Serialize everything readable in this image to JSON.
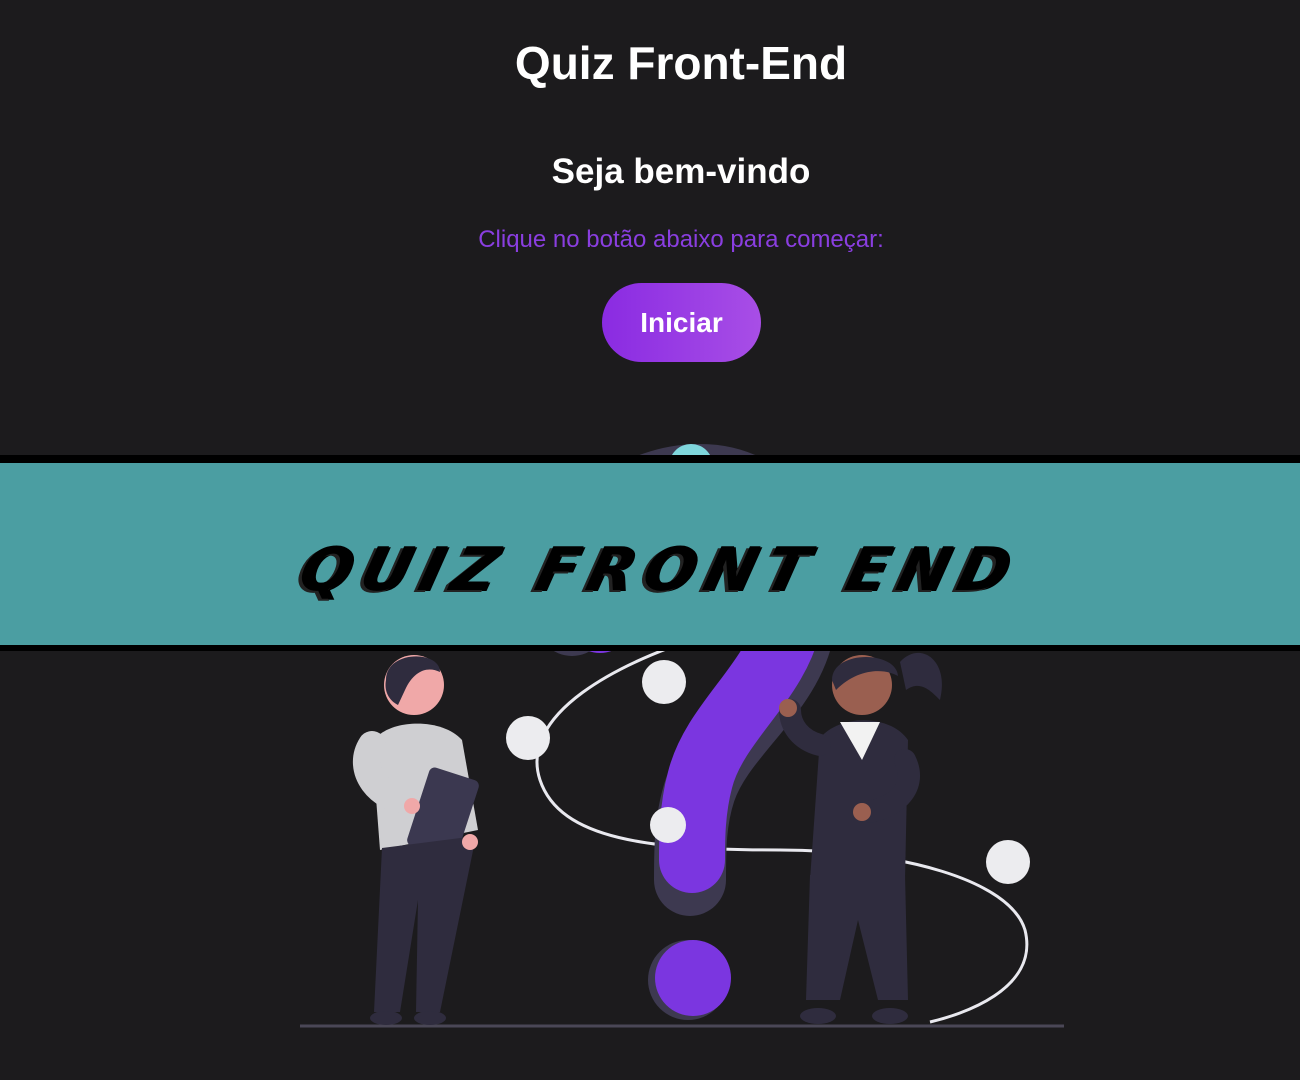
{
  "header": {
    "title": "Quiz Front-End"
  },
  "welcome": {
    "heading": "Seja bem-vindo",
    "instruction": "Clique no botão abaixo para começar:",
    "start_label": "Iniciar"
  },
  "banner": {
    "text": "QUIZ FRONT END"
  },
  "colors": {
    "background": "#1c1b1d",
    "accent": "#8a2be2",
    "banner": "#4ea3a7",
    "question_mark": "#7b36e0",
    "figure_dark": "#2f2c3e"
  },
  "illustration": {
    "icon": "question-mark-icon"
  }
}
